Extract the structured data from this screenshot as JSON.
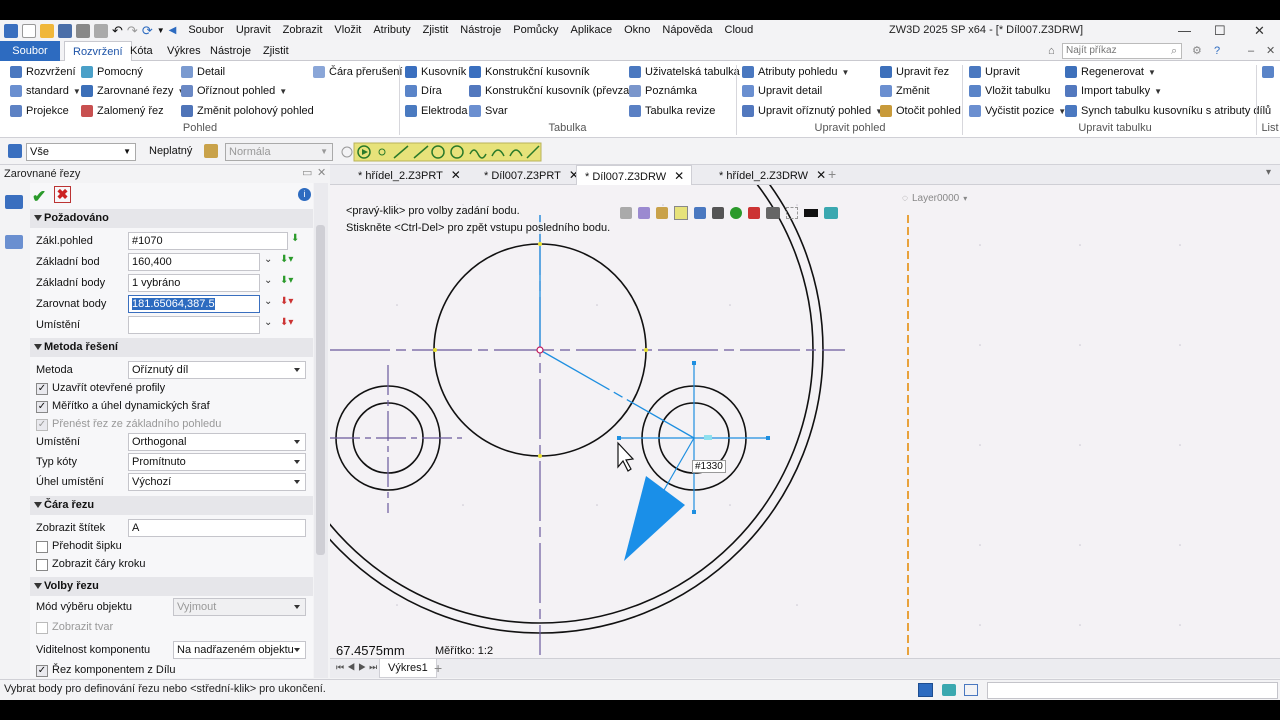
{
  "app": {
    "title": "ZW3D 2025 SP x64 - [* Díl007.Z3DRW]",
    "menu": [
      "Soubor",
      "Upravit",
      "Zobrazit",
      "Vložit",
      "Atributy",
      "Zjistit",
      "Nástroje",
      "Pomůcky",
      "Aplikace",
      "Okno",
      "Nápověda",
      "Cloud"
    ]
  },
  "ribbon_tabs": [
    "Soubor",
    "Rozvržení",
    "Kóta",
    "Výkres",
    "Nástroje",
    "Zjistit"
  ],
  "search": {
    "placeholder": "Najít příkaz"
  },
  "ribbon": {
    "pohled": {
      "title": "Pohled",
      "items": [
        "Rozvržení",
        "standard",
        "Projekce",
        "Pomocný",
        "Zarovnané řezy",
        "Zalomený řez",
        "Detail",
        "Oříznout pohled",
        "Změnit polohový pohled",
        "Čára přerušení"
      ]
    },
    "tabulka": {
      "title": "Tabulka",
      "items": [
        "Kusovník",
        "Díra",
        "Elektroda",
        "Konstrukční kusovník",
        "Konstrukční kusovník (převzatý)",
        "Svar",
        "Uživatelská tabulka",
        "Poznámka",
        "Tabulka revize"
      ]
    },
    "upravit_pohled": {
      "title": "Upravit pohled",
      "items": [
        "Atributy pohledu",
        "Upravit detail",
        "Upravit oříznutý pohled",
        "Upravit řez",
        "Změnit",
        "Otočit pohled"
      ]
    },
    "upravit_tabulku": {
      "title": "Upravit tabulku",
      "items": [
        "Upravit",
        "Vložit tabulku",
        "Vyčistit pozice",
        "Regenerovat",
        "Import tabulky",
        "Synch tabulku kusovníku s atributy dílů"
      ]
    },
    "list": {
      "title": "List"
    }
  },
  "toolbar2": {
    "filter": "Vše",
    "state": "Neplatný",
    "normal": "Normála"
  },
  "panel": {
    "title": "Zarovnané řezy",
    "pozadovano": {
      "title": "Požadováno",
      "zakl_pohled_label": "Zákl.pohled",
      "zakl_pohled": "#1070",
      "zakladni_bod_label": "Základní bod",
      "zakladni_bod": "160,400",
      "zakladni_body_label": "Základní body",
      "zakladni_body": "1 vybráno",
      "zarovnat_body_label": "Zarovnat body",
      "zarovnat_body": "181.65064,387.5",
      "umisteni_label": "Umístění",
      "umisteni": ""
    },
    "metoda": {
      "title": "Metoda řešení",
      "metoda_label": "Metoda",
      "metoda": "Oříznutý díl",
      "chk1": "Uzavřít otevřené profily",
      "chk2": "Měřítko a úhel dynamických šraf",
      "chk3": "Přenést řez ze základního pohledu",
      "umisteni_label": "Umístění",
      "umisteni": "Orthogonal",
      "typ_koty_label": "Typ kóty",
      "typ_koty": "Promítnuto",
      "uhel_label": "Úhel umístění",
      "uhel": "Výchozí"
    },
    "cara": {
      "title": "Čára řezu",
      "stitek_label": "Zobrazit štítek",
      "stitek": "A",
      "chk1": "Přehodit šipku",
      "chk2": "Zobrazit čáry kroku"
    },
    "volby": {
      "title": "Volby řezu",
      "mod_label": "Mód výběru objektu",
      "mod": "Vyjmout",
      "chk1": "Zobrazit tvar",
      "viditelnost_label": "Viditelnost komponentu",
      "viditelnost": "Na nadřazeném objektu",
      "chk2": "Řez komponentem z Dílu"
    }
  },
  "doc_tabs": [
    "* hřídel_2.Z3PRT",
    "* Díl007.Z3PRT",
    "* Díl007.Z3DRW",
    "* hřídel_2.Z3DRW"
  ],
  "canvas": {
    "prompt1": "<pravý-klik> pro volby zadání bodu.",
    "prompt2": "Stiskněte <Ctrl-Del> pro zpět vstupu posledního bodu.",
    "tag": "#1330",
    "measure": "67.4575mm",
    "scale": "Měřítko: 1:2",
    "layer": "Layer0000"
  },
  "sheet_tab": "Výkres1",
  "status": "Vybrat body pro definování řezu nebo <střední-klik> pro ukončení.",
  "colors": {
    "accent": "#2d6bc0",
    "center_line": "#6a5a9c",
    "selection": "#1e8fe0",
    "arrow": "#1a8fe8",
    "orange_line": "#e8a23c"
  }
}
